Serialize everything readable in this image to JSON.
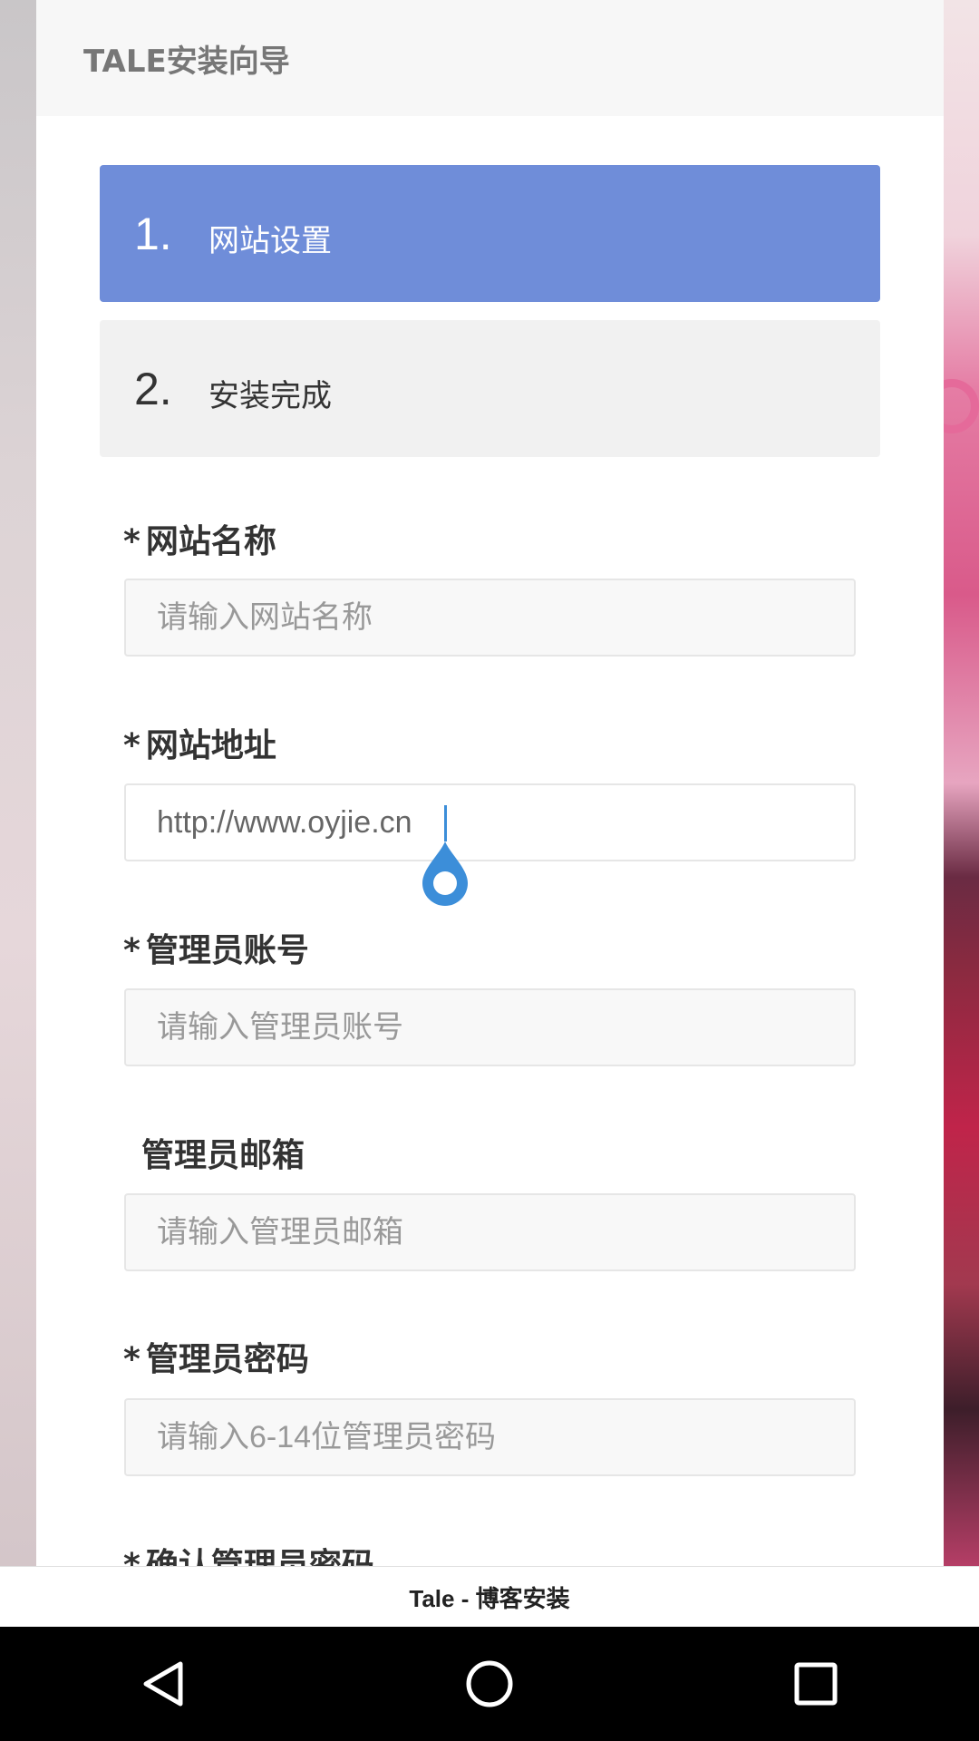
{
  "header": {
    "title": "TALE安装向导"
  },
  "steps": [
    {
      "number": "1.",
      "label": "网站设置",
      "state": "active"
    },
    {
      "number": "2.",
      "label": "安装完成",
      "state": "inactive"
    }
  ],
  "form": {
    "site_name": {
      "required": "*",
      "label": "网站名称",
      "placeholder": "请输入网站名称",
      "value": ""
    },
    "site_url": {
      "required": "*",
      "label": "网站地址",
      "placeholder": "",
      "value": "http://www.oyjie.cn"
    },
    "admin_account": {
      "required": "*",
      "label": "管理员账号",
      "placeholder": "请输入管理员账号",
      "value": ""
    },
    "admin_email": {
      "required": "",
      "label": "管理员邮箱",
      "placeholder": "请输入管理员邮箱",
      "value": ""
    },
    "admin_password": {
      "required": "*",
      "label": "管理员密码",
      "placeholder": "请输入6-14位管理员密码",
      "value": ""
    },
    "confirm_password": {
      "required": "*",
      "label": "确认管理员密码"
    }
  },
  "page_title": "Tale - 博客安装",
  "colors": {
    "accent": "#6f8dd9",
    "caret": "#3c8ed9"
  },
  "nav_icons": [
    "back-icon",
    "home-icon",
    "recents-icon"
  ]
}
